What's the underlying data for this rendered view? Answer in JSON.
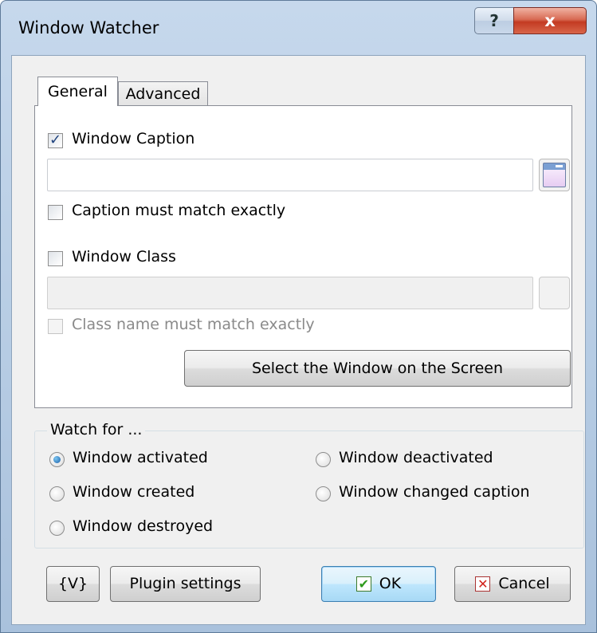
{
  "window": {
    "title": "Window Watcher",
    "help_label": "?",
    "close_label": "x"
  },
  "tabs": [
    {
      "label": "General",
      "active": true
    },
    {
      "label": "Advanced",
      "active": false
    }
  ],
  "general": {
    "window_caption": {
      "label": "Window Caption",
      "checked": true,
      "value": ""
    },
    "caption_exact": {
      "label": "Caption must match exactly",
      "checked": false
    },
    "window_class": {
      "label": "Window Class",
      "checked": false,
      "value": ""
    },
    "class_exact": {
      "label": "Class name must match exactly",
      "checked": false,
      "disabled": true
    },
    "select_button": "Select the Window on the Screen"
  },
  "watch": {
    "title": "Watch for ...",
    "options": [
      {
        "label": "Window activated",
        "checked": true
      },
      {
        "label": "Window deactivated",
        "checked": false
      },
      {
        "label": "Window created",
        "checked": false
      },
      {
        "label": "Window changed caption",
        "checked": false
      },
      {
        "label": "Window destroyed",
        "checked": false
      }
    ]
  },
  "footer": {
    "variables_label": "{V}",
    "plugin_settings_label": "Plugin settings",
    "ok_label": "OK",
    "cancel_label": "Cancel"
  },
  "icons": {
    "ok": "check-icon",
    "cancel": "x-icon",
    "window_picker": "window-icon"
  }
}
